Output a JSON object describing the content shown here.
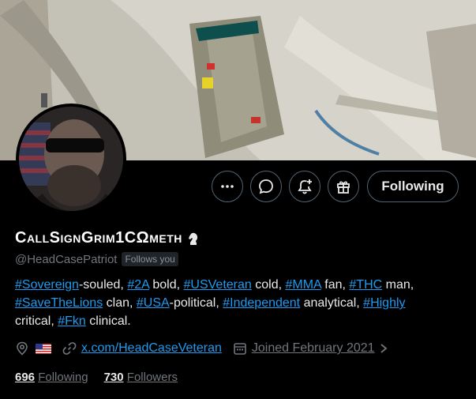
{
  "profile": {
    "display_name": "CallSignGrim1CΩmeth",
    "handle": "@HeadCasePatriot",
    "follows_you": "Follows you",
    "bio": {
      "t1": "#Sovereign",
      "s1": "-souled, ",
      "t2": "#2A",
      "s2": " bold, ",
      "t3": "#USVeteran",
      "s3": " cold, ",
      "t4": "#MMA",
      "s4": " fan, ",
      "t5": "#THC",
      "s5": " man,",
      "t6": "#SaveTheLions",
      "s6": " clan, ",
      "t7": "#USA",
      "s7": "-political, ",
      "t8": "#Independent",
      "s8": " analytical, ",
      "t9": "#Highly",
      "s9": " critical, ",
      "t10": "#Fkn",
      "s10": " clinical."
    },
    "website": "x.com/HeadCaseVeteran",
    "joined": "Joined February 2021",
    "following_count": "696",
    "following_label": "Following",
    "followers_count": "730",
    "followers_label": "Followers"
  },
  "actions": {
    "more_icon": "more-icon",
    "message_icon": "message-icon",
    "notify_icon": "bell-plus-icon",
    "subscribe_icon": "gift-icon",
    "follow_label": "Following"
  },
  "colors": {
    "accent": "#1d9bf0",
    "muted": "#71767b",
    "background": "#000000",
    "border": "#536471"
  }
}
